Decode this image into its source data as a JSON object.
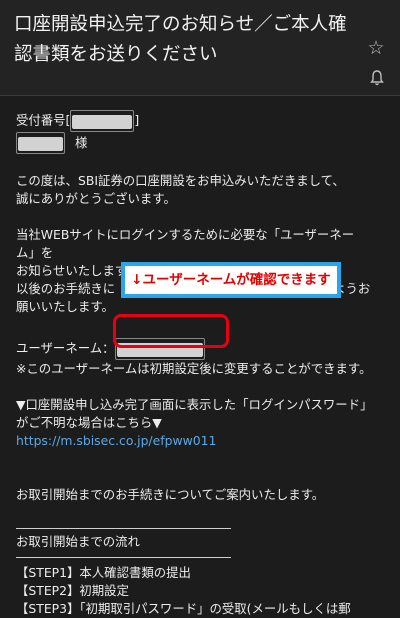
{
  "email": {
    "subject": "口座開設申込完了のお知らせ／ご本人確認書類をお送りください",
    "icons": {
      "favorite": "star-icon",
      "notify": "bell-icon"
    }
  },
  "body": {
    "receipt_label": "受付番号[",
    "receipt_close": "]",
    "honorific": "様",
    "p1_line1": "この度は、SBI証券の口座開設をお申込みいただきまして、",
    "p1_line2": "誠にありがとうございます。",
    "p2_line1": "当社WEBサイトにログインするために必要な「ユーザーネー",
    "p2_line2": "ム」を",
    "p2_line3": "お知らせいたします。",
    "p2_line4_start": "以後のお手続きに",
    "p2_line4_end": "ようお",
    "p2_line5": "願いいたします。",
    "username_label": "ユーザーネーム：",
    "username_note": "※このユーザーネームは初期設定後に変更することができます。",
    "pw_line1": "▼口座開設申し込み完了画面に表示した「ログインパスワード」",
    "pw_line2": "がご不明な場合はこちら▼",
    "pw_link": "https://m.sbisec.co.jp/efpww011",
    "guide_text": "お取引開始までのお手続きについてご案内いたします。",
    "flow_title": "お取引開始までの流れ",
    "steps": [
      "【STEP1】本人確認書類の提出",
      "【STEP2】初期設定",
      "【STEP3】「初期取引パスワード」の受取(メールもしくは郵"
    ]
  },
  "annotation": {
    "callout_text": "↓ユーザーネームが確認できます",
    "callout_border": "#2aa6e8",
    "callout_text_color": "#e40000",
    "ring_color": "#e50012"
  }
}
